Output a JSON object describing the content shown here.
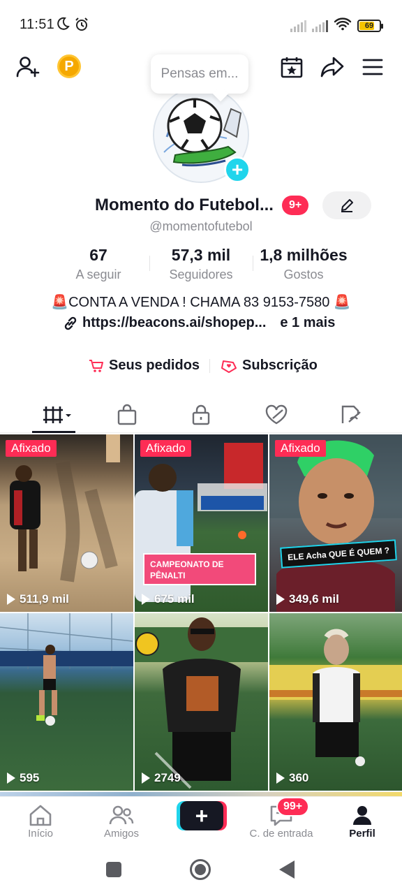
{
  "status_bar": {
    "time": "11:51",
    "battery": "69",
    "icons": [
      "moon-icon",
      "alarm-icon",
      "signal-icon",
      "signal-icon",
      "wifi-icon",
      "battery-icon"
    ]
  },
  "top_bar": {
    "icons": [
      "add-friend-icon",
      "coin-icon",
      "calendar-star-icon",
      "share-icon",
      "menu-icon"
    ],
    "coin_letter": "P"
  },
  "profile": {
    "bubble_text": "Pensas em...",
    "avatar_plus": "+",
    "name": "Momento do Futebol...",
    "badge": "9+",
    "handle": "@momentofutebol",
    "stats": [
      {
        "value": "67",
        "label": "A seguir"
      },
      {
        "value": "57,3 mil",
        "label": "Seguidores"
      },
      {
        "value": "1,8 milhões",
        "label": "Gostos"
      }
    ],
    "bio": "🚨CONTA A VENDA ! CHAMA  83 9153-7580 🚨",
    "link": "https://beacons.ai/shopep...",
    "link_more": "e 1 mais",
    "orders_label": "Seus pedidos",
    "subscription_label": "Subscrição"
  },
  "tabs": [
    "videos-tab",
    "shop-tab",
    "private-tab",
    "liked-tab",
    "hidden-tab"
  ],
  "videos": [
    {
      "pinned": "Afixado",
      "views": "511,9 mil"
    },
    {
      "pinned": "Afixado",
      "views": "675 mil",
      "overlay": "CAMPEONATO DE PÊNALTI"
    },
    {
      "pinned": "Afixado",
      "views": "349,6 mil",
      "overlay": "ELE Acha QUE É QUEM ?"
    },
    {
      "pinned": "",
      "views": "595"
    },
    {
      "pinned": "",
      "views": "2749"
    },
    {
      "pinned": "",
      "views": "360"
    }
  ],
  "bottom_nav": {
    "items": [
      {
        "label": "Início"
      },
      {
        "label": "Amigos"
      },
      {
        "label": "+"
      },
      {
        "label": "C. de entrada",
        "badge": "99+"
      },
      {
        "label": "Perfil"
      }
    ]
  },
  "colors": {
    "accent_red": "#fe2c55",
    "accent_cyan": "#20d5ec",
    "text": "#161823",
    "muted": "#8a8b91"
  }
}
